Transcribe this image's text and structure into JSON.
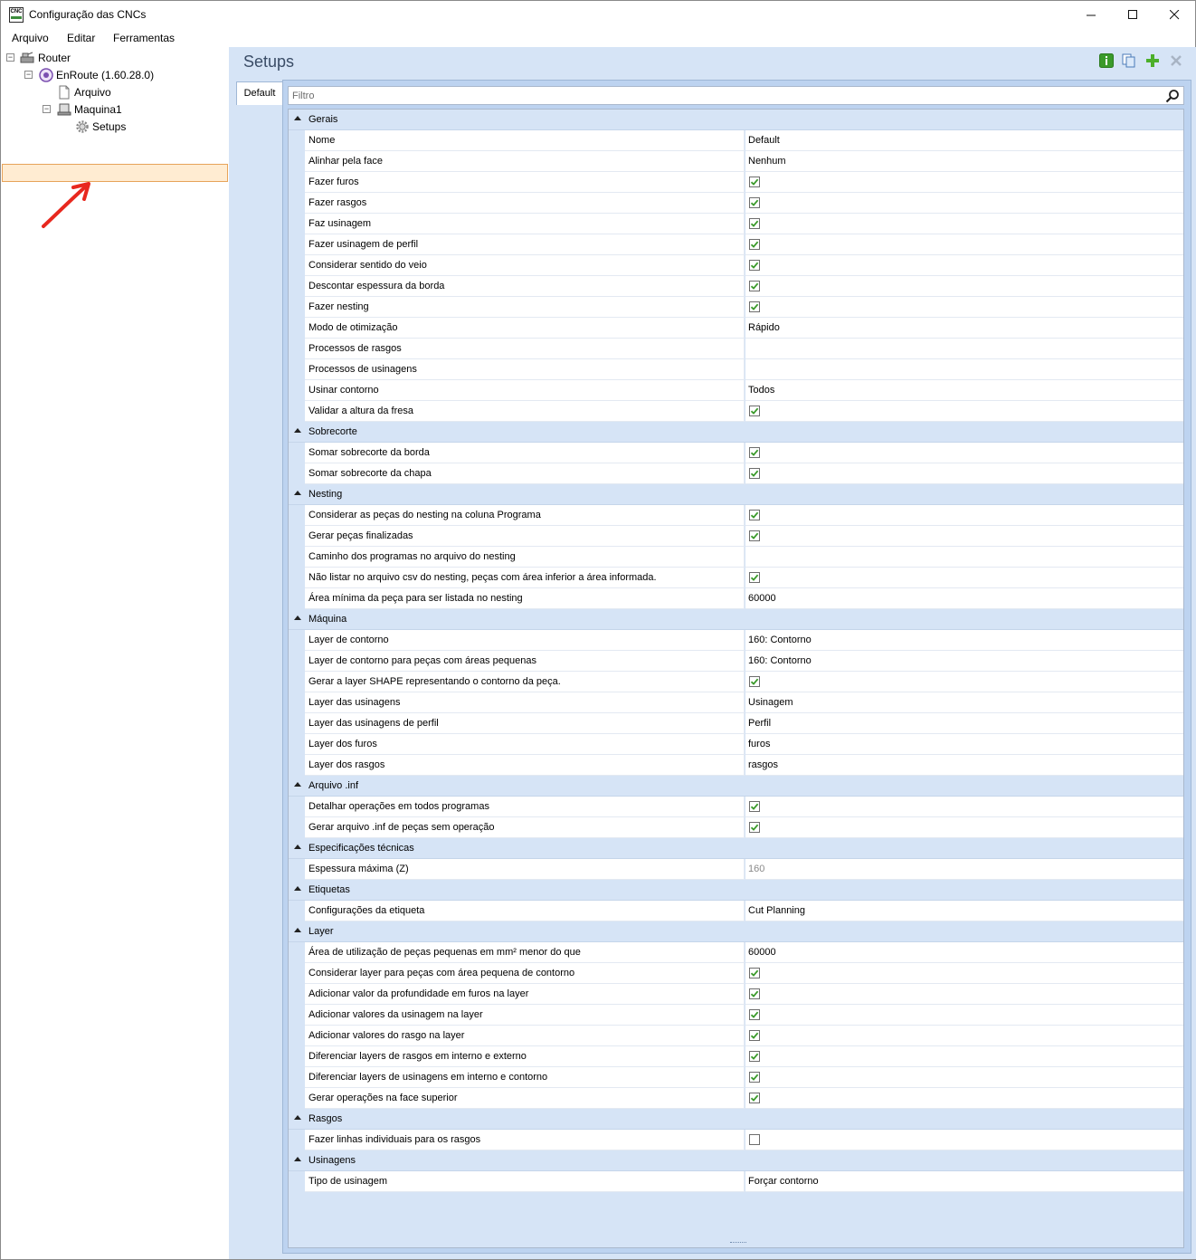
{
  "window": {
    "title": "Configuração das CNCs",
    "minimize_glyph": "—",
    "maximize_glyph": "☐",
    "close_glyph": "✕",
    "icon_text": "CNC"
  },
  "menu": [
    "Arquivo",
    "Editar",
    "Ferramentas"
  ],
  "tree": {
    "root": "Router",
    "enroute": "EnRoute (1.60.28.0)",
    "arquivo": "Arquivo",
    "maquina": "Maquina1",
    "setups": "Setups"
  },
  "header": {
    "title": "Setups",
    "toolbar_icons": [
      "info-icon",
      "copy-icon",
      "add-icon",
      "remove-icon"
    ]
  },
  "tabs": [
    "Default"
  ],
  "filter": {
    "placeholder": "Filtro",
    "value": ""
  },
  "colors": {
    "accent": "#3a9a2a",
    "selection": "#ffecd2",
    "panel_bg": "#d6e4f6"
  },
  "groups": [
    {
      "name": "Gerais",
      "props": [
        {
          "label": "Nome",
          "value": "Default"
        },
        {
          "label": "Alinhar pela face",
          "value": "Nenhum"
        },
        {
          "label": "Fazer furos",
          "check": true
        },
        {
          "label": "Fazer rasgos",
          "check": true
        },
        {
          "label": "Faz usinagem",
          "check": true
        },
        {
          "label": "Fazer usinagem de perfil",
          "check": true
        },
        {
          "label": "Considerar sentido do veio",
          "check": true
        },
        {
          "label": "Descontar espessura da borda",
          "check": true
        },
        {
          "label": "Fazer nesting",
          "check": true
        },
        {
          "label": "Modo de otimização",
          "value": "Rápido"
        },
        {
          "label": "Processos de rasgos",
          "value": ""
        },
        {
          "label": "Processos de usinagens",
          "value": ""
        },
        {
          "label": "Usinar contorno",
          "value": "Todos"
        },
        {
          "label": "Validar a altura da fresa",
          "check": true
        }
      ]
    },
    {
      "name": "Sobrecorte",
      "props": [
        {
          "label": "Somar sobrecorte da borda",
          "check": true
        },
        {
          "label": "Somar sobrecorte da chapa",
          "check": true
        }
      ]
    },
    {
      "name": "Nesting",
      "props": [
        {
          "label": "Considerar as peças do nesting na coluna Programa",
          "check": true
        },
        {
          "label": "Gerar peças finalizadas",
          "check": true
        },
        {
          "label": "Caminho dos programas no arquivo do nesting",
          "value": ""
        },
        {
          "label": "Não listar no arquivo csv do nesting, peças com área inferior a área informada.",
          "check": true
        },
        {
          "label": "Área mínima da peça para ser listada no nesting",
          "value": "60000"
        }
      ]
    },
    {
      "name": "Máquina",
      "props": [
        {
          "label": "Layer de contorno",
          "value": "160: Contorno"
        },
        {
          "label": "Layer de contorno para peças com áreas pequenas",
          "value": "160: Contorno"
        },
        {
          "label": "Gerar a layer SHAPE representando o contorno da peça.",
          "check": true
        },
        {
          "label": "Layer das usinagens",
          "value": "Usinagem"
        },
        {
          "label": "Layer das usinagens de perfil",
          "value": "Perfil"
        },
        {
          "label": "Layer dos furos",
          "value": "furos"
        },
        {
          "label": "Layer dos rasgos",
          "value": "rasgos"
        }
      ]
    },
    {
      "name": "Arquivo .inf",
      "props": [
        {
          "label": "Detalhar operações em todos programas",
          "check": true
        },
        {
          "label": "Gerar arquivo .inf de peças sem operação",
          "check": true
        }
      ]
    },
    {
      "name": "Especificações técnicas",
      "props": [
        {
          "label": "Espessura máxima (Z)",
          "value": "160",
          "disabled": true
        }
      ]
    },
    {
      "name": "Etiquetas",
      "props": [
        {
          "label": "Configurações da etiqueta",
          "value": "Cut Planning"
        }
      ]
    },
    {
      "name": "Layer",
      "props": [
        {
          "label": "Área de utilização de peças pequenas em mm² menor do que",
          "value": "60000"
        },
        {
          "label": "Considerar layer para peças com área pequena de contorno",
          "check": true
        },
        {
          "label": "Adicionar valor da profundidade em furos na layer",
          "check": true
        },
        {
          "label": "Adicionar valores da usinagem na layer",
          "check": true
        },
        {
          "label": "Adicionar valores do rasgo na layer",
          "check": true
        },
        {
          "label": "Diferenciar layers de rasgos em interno e externo",
          "check": true
        },
        {
          "label": "Diferenciar layers de usinagens em interno e contorno",
          "check": true
        },
        {
          "label": "Gerar operações na face superior",
          "check": true
        }
      ]
    },
    {
      "name": "Rasgos",
      "props": [
        {
          "label": "Fazer linhas individuais para os rasgos",
          "check": false
        }
      ]
    },
    {
      "name": "Usinagens",
      "props": [
        {
          "label": "Tipo de usinagem",
          "value": "Forçar contorno"
        }
      ]
    }
  ]
}
